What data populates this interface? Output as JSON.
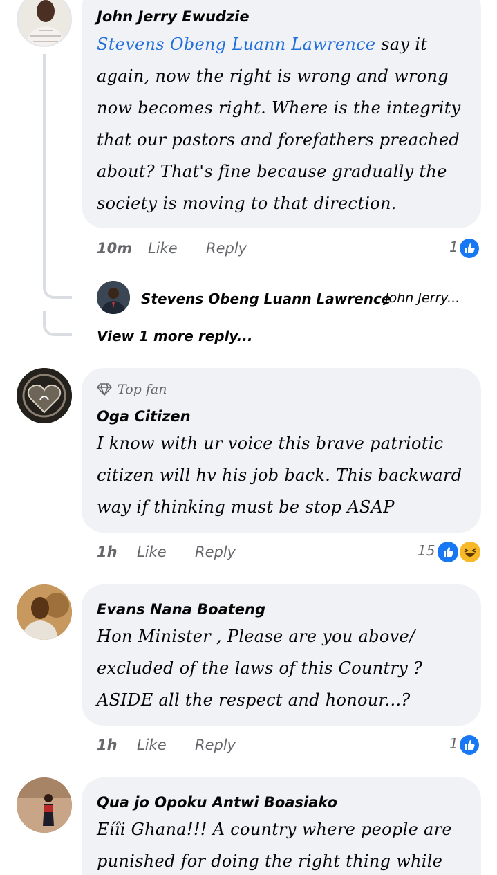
{
  "comments": [
    {
      "author": "John Jerry Ewudzie",
      "mention": "Stevens Obeng Luann Lawrence",
      "lines": [
        " say it",
        "again, now the right is wrong and wrong",
        "now becomes right. Where is the integrity",
        "that our pastors and forefathers preached",
        "about? That's fine because gradually the",
        "society is moving to that direction."
      ],
      "time": "10m",
      "like": "Like",
      "reply": "Reply",
      "reaction_count": "1",
      "reply_preview": {
        "author": "Stevens Obeng Luann Lawrence",
        "text": "John Jerry..."
      },
      "view_more": "View 1 more reply..."
    },
    {
      "badge": "Top fan",
      "author": "Oga Citizen",
      "lines": [
        "I know with ur voice this brave patriotic",
        "citizen will hv his  job back. This backward",
        "way if thinking must be stop ASAP"
      ],
      "time": "1h",
      "like": "Like",
      "reply": "Reply",
      "reaction_count": "15"
    },
    {
      "author": "Evans Nana Boateng",
      "lines": [
        "Hon Minister , Please are you above/",
        "excluded of the laws of this Country ?",
        "ASIDE all the respect and honour...?"
      ],
      "time": "1h",
      "like": "Like",
      "reply": "Reply",
      "reaction_count": "1"
    },
    {
      "author": "Qua jo Opoku Antwi Boasiako",
      "lines": [
        "Eíîi Ghana!!! A country where people are",
        "punished for doing the right thing while"
      ]
    }
  ],
  "colors": {
    "bubble": "#f0f2f5",
    "mention": "#216fdb",
    "like_blue": "#1877f2",
    "haha_yellow": "#f7b928",
    "meta_gray": "#65676b"
  }
}
